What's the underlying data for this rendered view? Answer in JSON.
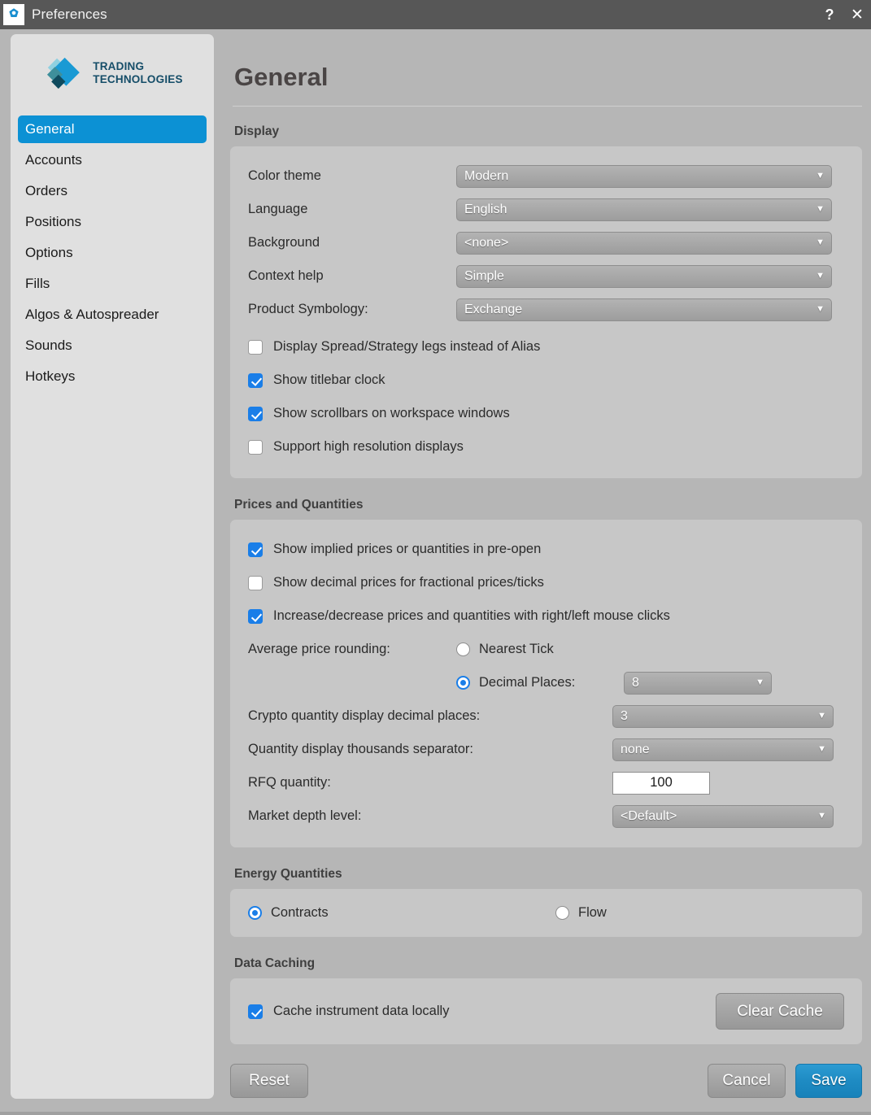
{
  "window": {
    "title": "Preferences",
    "icon": "gear-icon",
    "help_label": "?",
    "close_label": "✕"
  },
  "sidebar": {
    "logo": {
      "line1": "TRADING",
      "line2": "TECHNOLOGIES"
    },
    "items": [
      {
        "label": "General",
        "active": true
      },
      {
        "label": "Accounts",
        "active": false
      },
      {
        "label": "Orders",
        "active": false
      },
      {
        "label": "Positions",
        "active": false
      },
      {
        "label": "Options",
        "active": false
      },
      {
        "label": "Fills",
        "active": false
      },
      {
        "label": "Algos & Autospreader",
        "active": false
      },
      {
        "label": "Sounds",
        "active": false
      },
      {
        "label": "Hotkeys",
        "active": false
      }
    ]
  },
  "page": {
    "title": "General"
  },
  "display": {
    "heading": "Display",
    "fields": [
      {
        "label": "Color theme",
        "value": "Modern"
      },
      {
        "label": "Language",
        "value": "English"
      },
      {
        "label": "Background",
        "value": "<none>"
      },
      {
        "label": "Context help",
        "value": "Simple"
      },
      {
        "label": "Product Symbology:",
        "value": "Exchange"
      }
    ],
    "checkboxes": [
      {
        "label": "Display Spread/Strategy legs instead of Alias",
        "checked": false
      },
      {
        "label": "Show titlebar clock",
        "checked": true
      },
      {
        "label": "Show scrollbars on workspace windows",
        "checked": true
      },
      {
        "label": "Support high resolution displays",
        "checked": false
      }
    ]
  },
  "prices": {
    "heading": "Prices and Quantities",
    "checkboxes": [
      {
        "label": "Show implied prices or quantities in pre-open",
        "checked": true
      },
      {
        "label": "Show decimal prices for fractional prices/ticks",
        "checked": false
      },
      {
        "label": "Increase/decrease prices and quantities with right/left mouse clicks",
        "checked": true
      }
    ],
    "rounding": {
      "label": "Average price rounding:",
      "option_nearest_tick": "Nearest Tick",
      "option_decimal_places": "Decimal Places:",
      "selected": "decimal_places",
      "decimal_places_value": "8"
    },
    "fields": [
      {
        "label": "Crypto quantity display decimal places:",
        "value": "3",
        "type": "dropdown"
      },
      {
        "label": "Quantity display thousands separator:",
        "value": "none",
        "type": "dropdown"
      },
      {
        "label": "RFQ quantity:",
        "value": "100",
        "type": "text"
      },
      {
        "label": "Market depth level:",
        "value": "<Default>",
        "type": "dropdown"
      }
    ]
  },
  "energy": {
    "heading": "Energy Quantities",
    "option_contracts": "Contracts",
    "option_flow": "Flow",
    "selected": "contracts"
  },
  "caching": {
    "heading": "Data Caching",
    "checkbox_label": "Cache instrument data locally",
    "checkbox_checked": true,
    "clear_button": "Clear Cache"
  },
  "footer": {
    "reset": "Reset",
    "cancel": "Cancel",
    "save": "Save"
  },
  "colors": {
    "accent_blue": "#0c91d4",
    "checkbox_blue": "#1a7ee8",
    "save_blue": "#1e8bc3",
    "titlebar": "#575757",
    "sidebar_bg": "#e0e0e0",
    "window_bg": "#b6b6b6",
    "panel_bg": "#c7c7c7",
    "logo_teal": "#154d68"
  }
}
